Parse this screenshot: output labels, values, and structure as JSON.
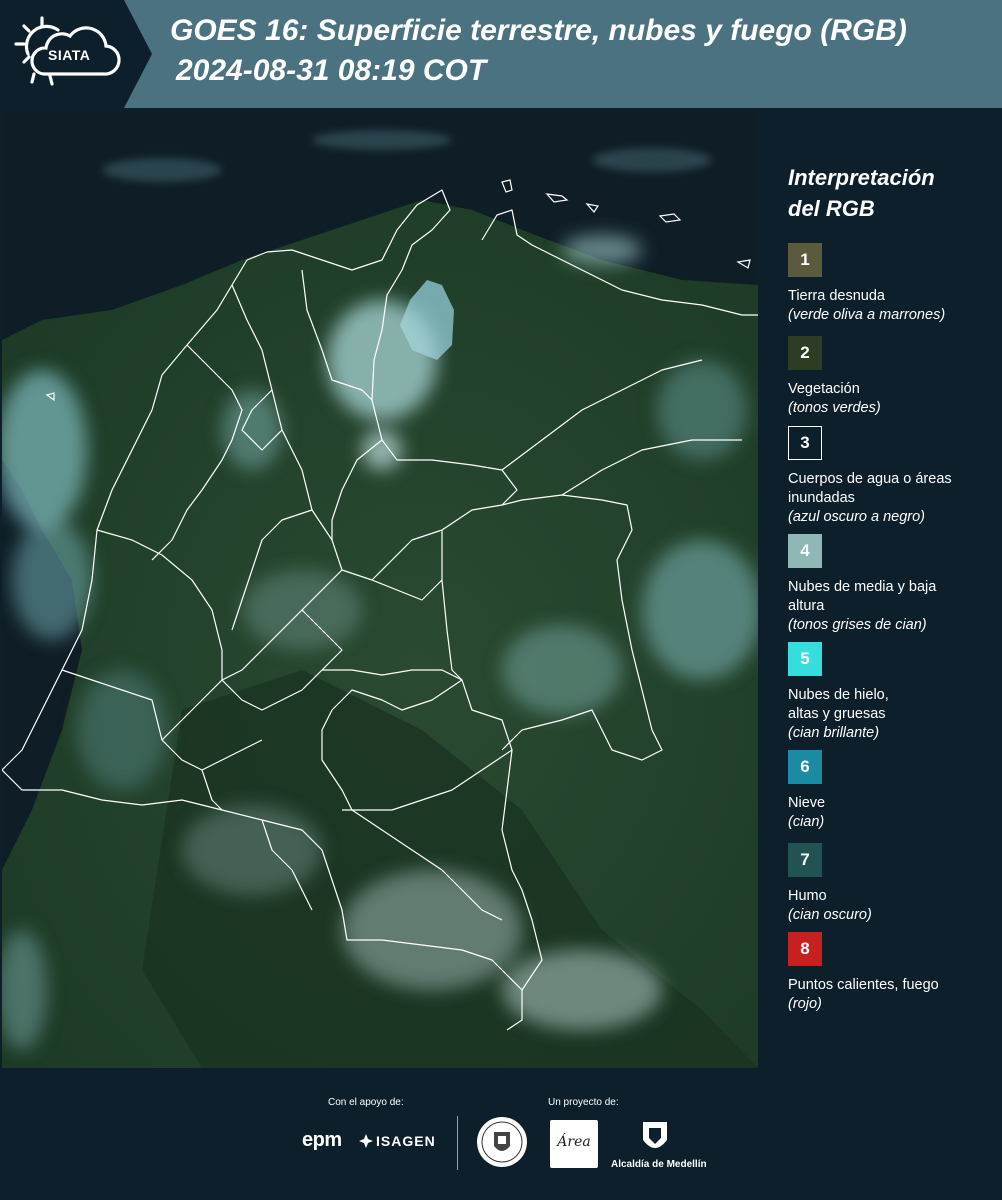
{
  "header": {
    "logo_text": "SIATA",
    "title": "GOES 16: Superficie terrestre, nubes y fuego (RGB)",
    "datetime": "2024-08-31 08:19 COT"
  },
  "legend": {
    "title_line1": "Interpretación",
    "title_line2": "del RGB",
    "items": [
      {
        "number": "1",
        "label": "Tierra desnuda",
        "desc": "(verde oliva a marrones)",
        "color": "#5b5a3c"
      },
      {
        "number": "2",
        "label": "Vegetación",
        "desc": "(tonos verdes)",
        "color": "#2c3d22"
      },
      {
        "number": "3",
        "label": "Cuerpos de agua o áreas inundadas",
        "desc": "(azul oscuro a negro)",
        "color": "#0d1f2b"
      },
      {
        "number": "4",
        "label": "Nubes de media y baja altura",
        "desc": "(tonos grises de cian)",
        "color": "#8fb7b5"
      },
      {
        "number": "5",
        "label": "Nubes de hielo, altas y gruesas",
        "desc": "(cian brillante)",
        "color": "#35dedc"
      },
      {
        "number": "6",
        "label": "Nieve",
        "desc": "(cian)",
        "color": "#1b8aa3"
      },
      {
        "number": "7",
        "label": "Humo",
        "desc": "(cian oscuro)",
        "color": "#215353"
      },
      {
        "number": "8",
        "label": "Puntos calientes, fuego",
        "desc": "(rojo)",
        "color": "#c8201e"
      }
    ]
  },
  "footer": {
    "support_label": "Con el apoyo de:",
    "project_label": "Un proyecto de:",
    "sponsors": [
      "epm",
      "ISAGEN"
    ],
    "area_text": "Área",
    "alcaldia": "Alcaldía de Medellín"
  }
}
